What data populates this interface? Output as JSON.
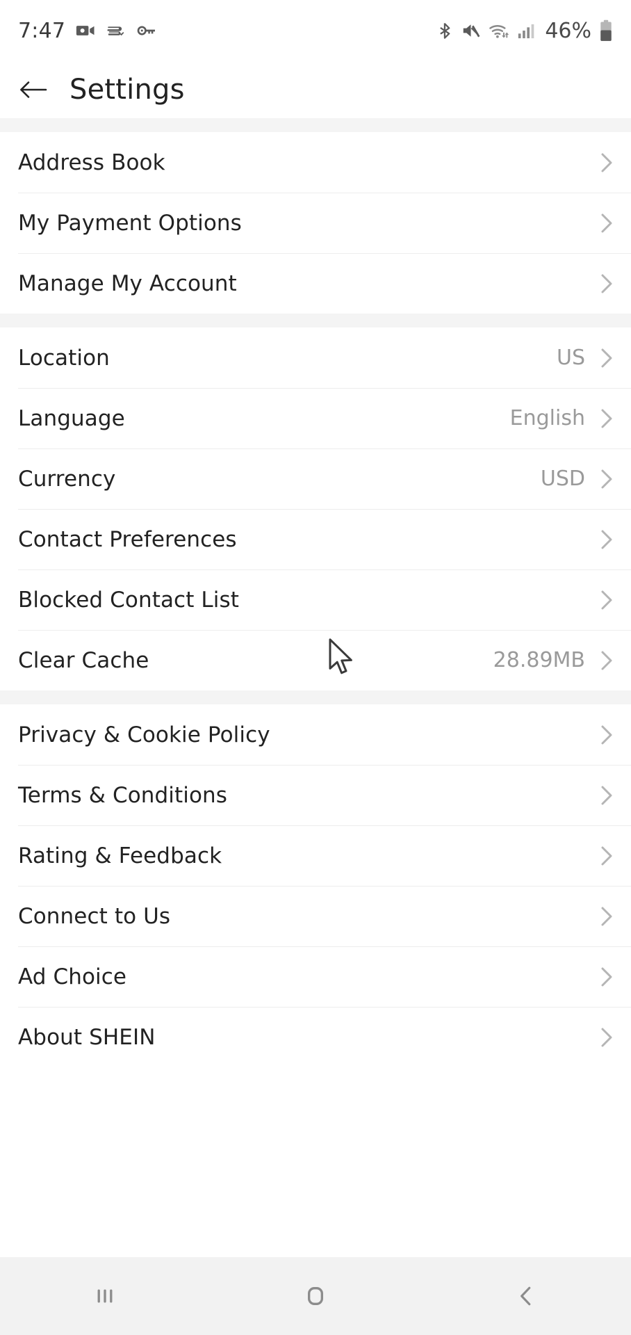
{
  "status_bar": {
    "time": "7:47",
    "battery_percent": "46%",
    "left_icons": [
      "video-camera-icon",
      "vpn-key-shield-icon",
      "key-icon"
    ],
    "right_icons": [
      "bluetooth-icon",
      "volume-muted-icon",
      "wifi-icon",
      "cellular-signal-icon",
      "battery-icon"
    ],
    "battery_level": 46
  },
  "header": {
    "title": "Settings",
    "back_label": "back-arrow"
  },
  "sections": [
    {
      "rows": [
        {
          "label": "Address Book",
          "value": ""
        },
        {
          "label": "My Payment Options",
          "value": ""
        },
        {
          "label": "Manage My Account",
          "value": ""
        }
      ]
    },
    {
      "rows": [
        {
          "label": "Location",
          "value": "US"
        },
        {
          "label": "Language",
          "value": "English"
        },
        {
          "label": "Currency",
          "value": "USD"
        },
        {
          "label": "Contact Preferences",
          "value": ""
        },
        {
          "label": "Blocked Contact List",
          "value": ""
        },
        {
          "label": "Clear Cache",
          "value": "28.89MB"
        }
      ]
    },
    {
      "rows": [
        {
          "label": "Privacy & Cookie Policy",
          "value": ""
        },
        {
          "label": "Terms & Conditions",
          "value": ""
        },
        {
          "label": "Rating & Feedback",
          "value": ""
        },
        {
          "label": "Connect to Us",
          "value": ""
        },
        {
          "label": "Ad Choice",
          "value": ""
        },
        {
          "label": "About SHEIN",
          "value": ""
        }
      ]
    }
  ],
  "nav_bar": {
    "buttons": [
      {
        "name": "recents-button",
        "icon": "recents-icon"
      },
      {
        "name": "home-button",
        "icon": "home-icon"
      },
      {
        "name": "back-button",
        "icon": "back-chevron-icon"
      }
    ]
  },
  "colors": {
    "background": "#ffffff",
    "section_gap": "#f4f4f4",
    "divider": "#ededed",
    "label_text": "#222222",
    "value_text": "#9a9a9a",
    "chevron": "#b5b5b5",
    "navbar_bg": "#f2f2f2"
  }
}
